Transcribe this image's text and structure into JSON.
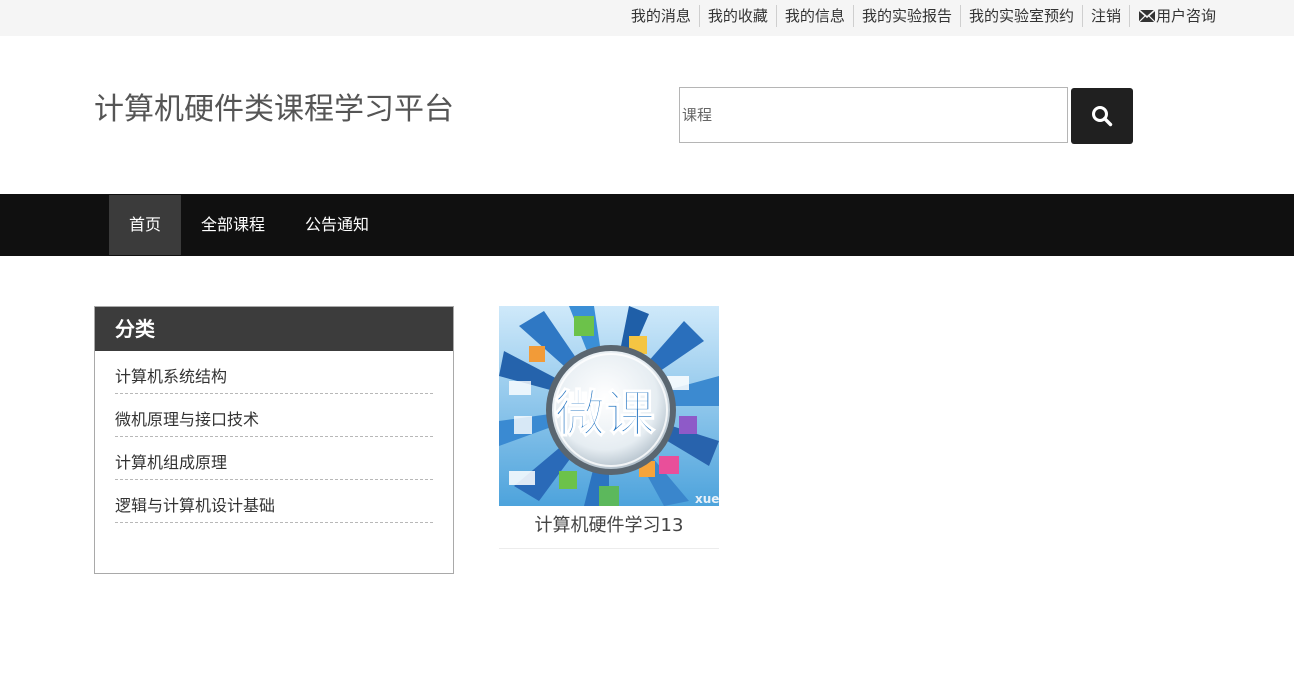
{
  "topbar": {
    "links": [
      "我的消息",
      "我的收藏",
      "我的信息",
      "我的实验报告",
      "我的实验室预约",
      "注销"
    ],
    "consult_label": "用户咨询",
    "consult_icon": "mail-icon"
  },
  "header": {
    "title": "计算机硬件类课程学习平台",
    "search_placeholder": "课程",
    "search_icon": "search-icon"
  },
  "nav": {
    "items": [
      "首页",
      "全部课程",
      "公告通知"
    ],
    "active": "首页"
  },
  "categories": {
    "title": "分类",
    "items": [
      "计算机系统结构",
      "微机原理与接口技术",
      "计算机组成原理",
      "逻辑与计算机设计基础"
    ]
  },
  "courses": [
    {
      "title": "计算机硬件学习13",
      "thumbnail_text": "微课",
      "thumbnail_caption": "xue"
    }
  ],
  "colors": {
    "topbar_bg": "#f5f5f5",
    "navbar_bg": "#101010",
    "nav_active_bg": "#3b3b3b",
    "panel_header_bg": "#3c3c3c",
    "search_button_bg": "#202020",
    "thumb_text_blue": "#1b6fbf"
  }
}
